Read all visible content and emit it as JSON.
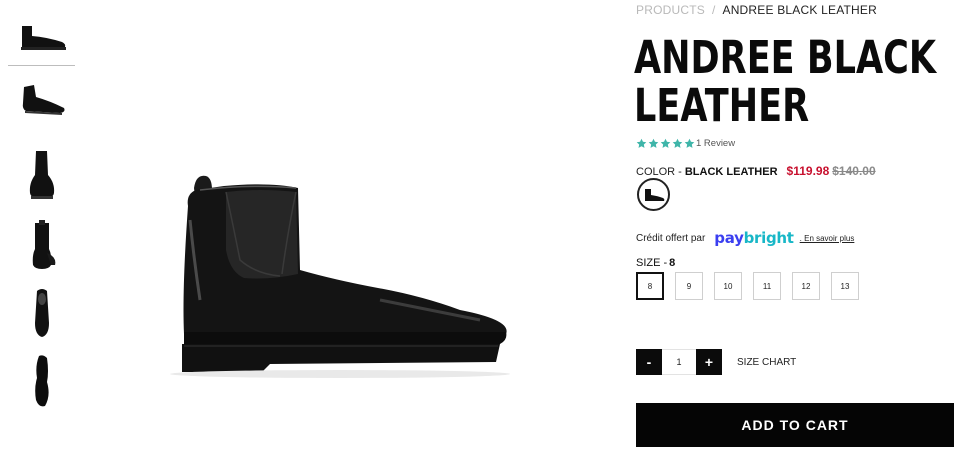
{
  "breadcrumb": {
    "parent": "PRODUCTS",
    "separator": "/",
    "current": "ANDREE BLACK LEATHER"
  },
  "product": {
    "title": "ANDREE BLACK LEATHER",
    "rating": {
      "stars": 5,
      "review_text": "1 Review"
    },
    "color_label": "COLOR -",
    "color_value": "BLACK LEATHER",
    "sale_price": "$119.98",
    "original_price": "$140.00"
  },
  "credit": {
    "text": "Crédit offert par",
    "brand_pay": "pay",
    "brand_bright": "bright",
    "learn_more": ". En savoir plus"
  },
  "size": {
    "label": "SIZE -",
    "selected": "8",
    "options": [
      "8",
      "9",
      "10",
      "11",
      "12",
      "13"
    ]
  },
  "quantity": {
    "decrement": "-",
    "value": "1",
    "increment": "+"
  },
  "size_chart": "SIZE CHART",
  "add_to_cart": "ADD TO CART",
  "colors": {
    "star": "#3fb5a9",
    "sale": "#c8102e",
    "paybright_pay": "#3b3ff0",
    "paybright_bright": "#18b7c7",
    "button": "#050505"
  },
  "thumbnails": [
    {
      "view": "side",
      "icon": "boot-side-icon",
      "active": true
    },
    {
      "view": "angle",
      "icon": "boot-angle-icon",
      "active": false
    },
    {
      "view": "front",
      "icon": "boot-front-icon",
      "active": false
    },
    {
      "view": "back",
      "icon": "boot-back-icon",
      "active": false
    },
    {
      "view": "top",
      "icon": "boot-top-icon",
      "active": false
    },
    {
      "view": "sole",
      "icon": "boot-sole-icon",
      "active": false
    }
  ]
}
